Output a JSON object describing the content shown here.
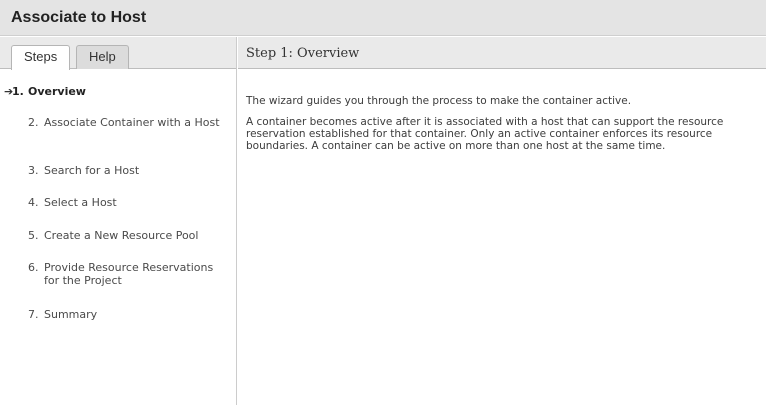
{
  "window": {
    "title": "Associate to Host"
  },
  "tabs": [
    {
      "label": "Steps"
    },
    {
      "label": "Help"
    }
  ],
  "steps": [
    {
      "number": "1.",
      "label": "Overview",
      "current": true
    },
    {
      "number": "2.",
      "label": "Associate Container with a Host"
    },
    {
      "number": "3.",
      "label": "Search for a Host"
    },
    {
      "number": "4.",
      "label": "Select a Host"
    },
    {
      "number": "5.",
      "label": "Create a New Resource Pool"
    },
    {
      "number": "6.",
      "label": "Provide Resource Reservations for the Project"
    },
    {
      "number": "7.",
      "label": "Summary"
    }
  ],
  "current_step": {
    "title": "Step 1:  Overview",
    "paragraphs": [
      "The wizard guides you through the process to make the container active.",
      "A container becomes active after it is associated with a host that can support the resource reservation established for that container. Only an active container enforces its resource boundaries. A container can be active on more than one host at the same time."
    ]
  },
  "icons": {
    "current_step_marker": "arrow-right-icon"
  }
}
